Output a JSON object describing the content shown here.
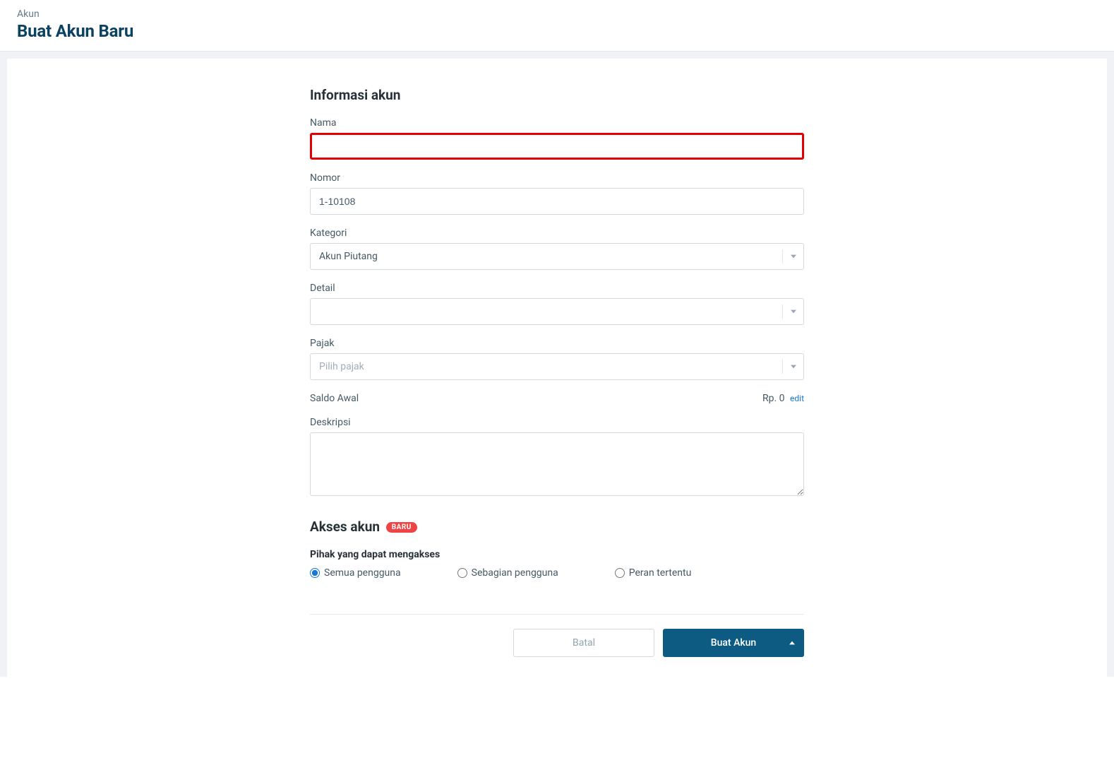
{
  "header": {
    "breadcrumb": "Akun",
    "title": "Buat Akun Baru"
  },
  "form": {
    "section_title": "Informasi akun",
    "nama": {
      "label": "Nama",
      "value": ""
    },
    "nomor": {
      "label": "Nomor",
      "value": "1-10108"
    },
    "kategori": {
      "label": "Kategori",
      "selected": "Akun Piutang"
    },
    "detail": {
      "label": "Detail",
      "selected": ""
    },
    "pajak": {
      "label": "Pajak",
      "placeholder": "Pilih pajak"
    },
    "saldo_awal": {
      "label": "Saldo Awal",
      "value": "Rp. 0",
      "edit_label": "edit"
    },
    "deskripsi": {
      "label": "Deskripsi",
      "value": ""
    }
  },
  "access": {
    "section_title": "Akses akun",
    "badge": "BARU",
    "subtitle": "Pihak yang dapat mengakses",
    "options": {
      "all": "Semua pengguna",
      "some": "Sebagian pengguna",
      "roles": "Peran tertentu"
    },
    "selected": "all"
  },
  "actions": {
    "cancel": "Batal",
    "submit": "Buat Akun"
  }
}
